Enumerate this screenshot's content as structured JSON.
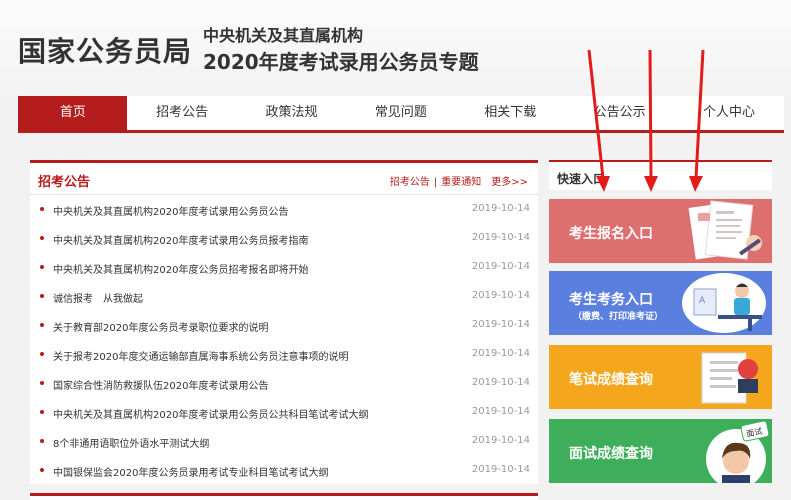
{
  "header": {
    "logo": "国家公务员局",
    "subtitle_line1": "中央机关及其直属机构",
    "subtitle_line2": "2020年度考试录用公务员专题"
  },
  "nav": {
    "items": [
      {
        "label": "首页",
        "active": true
      },
      {
        "label": "招考公告"
      },
      {
        "label": "政策法规"
      },
      {
        "label": "常见问题"
      },
      {
        "label": "相关下载"
      },
      {
        "label": "公告公示"
      },
      {
        "label": "个人中心"
      }
    ]
  },
  "announcements": {
    "title": "招考公告",
    "link1": "招考公告",
    "separator": "|",
    "link2": "重要通知",
    "more": "更多>>",
    "items": [
      {
        "title": "中央机关及其直属机构2020年度考试录用公务员公告",
        "date": "2019-10-14"
      },
      {
        "title": "中央机关及其直属机构2020年度考试录用公务员报考指南",
        "date": "2019-10-14"
      },
      {
        "title": "中央机关及其直属机构2020年度公务员招考报名即将开始",
        "date": "2019-10-14"
      },
      {
        "title": "诚信报考　从我做起",
        "date": "2019-10-14"
      },
      {
        "title": "关于教育部2020年度公务员考录职位要求的说明",
        "date": "2019-10-14"
      },
      {
        "title": "关于报考2020年度交通运输部直属海事系统公务员注意事项的说明",
        "date": "2019-10-14"
      },
      {
        "title": "国家综合性消防救援队伍2020年度考试录用公告",
        "date": "2019-10-14"
      },
      {
        "title": "中央机关及其直属机构2020年度考试录用公务员公共科目笔试考试大纲",
        "date": "2019-10-14"
      },
      {
        "title": "8个非通用语职位外语水平测试大纲",
        "date": "2019-10-14"
      },
      {
        "title": "中国银保监会2020年度公务员录用考试专业科目笔试考试大纲",
        "date": "2019-10-14"
      }
    ]
  },
  "quick": {
    "title": "快速入口",
    "cards": [
      {
        "label": "考生报名入口",
        "color": "#de6f6f"
      },
      {
        "label": "考生考务入口",
        "note": "（缴费、打印准考证）",
        "color": "#5b7fde"
      },
      {
        "label": "笔试成绩查询",
        "color": "#f4a61d"
      },
      {
        "label": "面试成绩查询",
        "badge": "面试",
        "color": "#3fae5a"
      }
    ]
  },
  "colors": {
    "brand": "#b51c1c",
    "arrow": "#e31b1b"
  },
  "icons": [
    "registration-form-icon",
    "exam-desk-icon",
    "score-report-icon",
    "interviewer-avatar-icon",
    "arrow-icon"
  ]
}
